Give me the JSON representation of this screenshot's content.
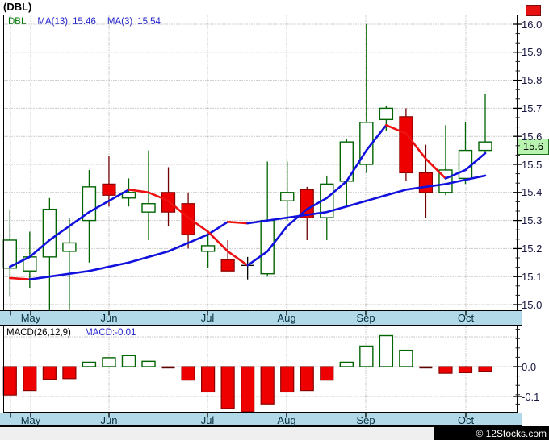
{
  "window": {
    "title": "(DBL)"
  },
  "price_panel": {
    "legend": {
      "symbol": "DBL",
      "ma13_label": "MA(13)",
      "ma13_value": "15.46",
      "ma3_label": "MA(3)",
      "ma3_value": "15.54"
    },
    "current_price": "15.6",
    "ytick_labels": [
      "16.0",
      "15.9",
      "15.8",
      "15.7",
      "15.6",
      "15.5",
      "15.4",
      "15.3",
      "15.2",
      "15.1",
      "15.0"
    ]
  },
  "macd_panel": {
    "legend_label": "MACD(26,12,9)",
    "legend_value": "MACD:-0.01",
    "ytick_labels": [
      "0.0",
      "-0.1"
    ]
  },
  "footer": {
    "copyright": "© 12Stocks.com"
  },
  "colors": {
    "band_blue": "#b2d9e8",
    "candle_up_stroke": "#006400",
    "candle_down_fill": "#ee0000",
    "candle_down_stroke": "#8b0000",
    "down_wick": "#700000",
    "doji": "#000000",
    "ma_rising_blue": "#1111dd",
    "ma_falling_red": "#ee1111",
    "grid": "#9a9a9a",
    "price_badge_bg": "#b9f3b0",
    "macd_flat_bar": "#5c0000",
    "legend_blue": "#2222cc",
    "symbol_green": "#007700",
    "red_button": "#e81111"
  },
  "chart_data": [
    {
      "type": "candlestick",
      "title": "(DBL)",
      "ylabel": "price",
      "ylim": [
        14.97,
        16.03
      ],
      "yticks": [
        16.0,
        15.9,
        15.8,
        15.7,
        15.6,
        15.5,
        15.4,
        15.3,
        15.2,
        15.1,
        15.0
      ],
      "grid": true,
      "month_ticks": [
        {
          "label": "May",
          "x": 38
        },
        {
          "label": "Jun",
          "x": 135
        },
        {
          "label": "Jul",
          "x": 257
        },
        {
          "label": "Aug",
          "x": 355
        },
        {
          "label": "Sep",
          "x": 453
        },
        {
          "label": "Oct",
          "x": 577
        }
      ],
      "lead_tick_x": 13,
      "candles": [
        {
          "o": 15.13,
          "h": 15.34,
          "l": 15.03,
          "c": 15.23
        },
        {
          "o": 15.12,
          "h": 15.26,
          "l": 15.06,
          "c": 15.17
        },
        {
          "o": 15.17,
          "h": 15.38,
          "l": 14.98,
          "c": 15.34
        },
        {
          "o": 15.19,
          "h": 15.31,
          "l": 14.98,
          "c": 15.22
        },
        {
          "o": 15.3,
          "h": 15.48,
          "l": 15.15,
          "c": 15.42
        },
        {
          "o": 15.43,
          "h": 15.53,
          "l": 15.35,
          "c": 15.39
        },
        {
          "o": 15.38,
          "h": 15.45,
          "l": 15.35,
          "c": 15.4
        },
        {
          "o": 15.33,
          "h": 15.55,
          "l": 15.23,
          "c": 15.36
        },
        {
          "o": 15.4,
          "h": 15.49,
          "l": 15.28,
          "c": 15.33
        },
        {
          "o": 15.36,
          "h": 15.4,
          "l": 15.2,
          "c": 15.25
        },
        {
          "o": 15.19,
          "h": 15.25,
          "l": 15.13,
          "c": 15.21
        },
        {
          "o": 15.16,
          "h": 15.23,
          "l": 15.12,
          "c": 15.12
        },
        {
          "o": 15.14,
          "h": 15.17,
          "l": 15.09,
          "c": 15.14
        },
        {
          "o": 15.11,
          "h": 15.51,
          "l": 15.1,
          "c": 15.3
        },
        {
          "o": 15.37,
          "h": 15.51,
          "l": 15.3,
          "c": 15.4
        },
        {
          "o": 15.41,
          "h": 15.42,
          "l": 15.23,
          "c": 15.31
        },
        {
          "o": 15.31,
          "h": 15.46,
          "l": 15.23,
          "c": 15.43
        },
        {
          "o": 15.44,
          "h": 15.59,
          "l": 15.35,
          "c": 15.58
        },
        {
          "o": 15.5,
          "h": 16.0,
          "l": 15.47,
          "c": 15.65
        },
        {
          "o": 15.66,
          "h": 15.71,
          "l": 15.62,
          "c": 15.7
        },
        {
          "o": 15.67,
          "h": 15.7,
          "l": 15.44,
          "c": 15.47
        },
        {
          "o": 15.47,
          "h": 15.57,
          "l": 15.31,
          "c": 15.4
        },
        {
          "o": 15.4,
          "h": 15.64,
          "l": 15.39,
          "c": 15.48
        },
        {
          "o": 15.45,
          "h": 15.65,
          "l": 15.43,
          "c": 15.55
        },
        {
          "o": 15.55,
          "h": 15.75,
          "l": 15.54,
          "c": 15.58
        }
      ],
      "ma3": {
        "name": "MA(3)",
        "last": 15.54,
        "values": [
          15.135,
          15.17,
          15.23,
          15.28,
          15.33,
          15.37,
          15.41,
          15.4,
          15.37,
          15.31,
          15.26,
          15.19,
          15.14,
          15.19,
          15.28,
          15.34,
          15.38,
          15.44,
          15.55,
          15.64,
          15.61,
          15.52,
          15.45,
          15.48,
          15.54
        ]
      },
      "ma13": {
        "name": "MA(13)",
        "last": 15.46,
        "values": [
          15.095,
          15.09,
          15.1,
          15.11,
          15.12,
          15.135,
          15.15,
          15.17,
          15.19,
          15.22,
          15.25,
          15.295,
          15.29,
          15.3,
          15.31,
          15.32,
          15.33,
          15.35,
          15.37,
          15.39,
          15.41,
          15.42,
          15.43,
          15.445,
          15.46
        ]
      }
    },
    {
      "type": "bar",
      "title": "MACD(26,12,9)",
      "last_value_label": "MACD:-0.01",
      "yticks": [
        0.0,
        -0.1
      ],
      "ylim": [
        -0.155,
        0.138
      ],
      "grid": true,
      "values": [
        -0.095,
        -0.08,
        -0.042,
        -0.04,
        0.015,
        0.03,
        0.037,
        0.018,
        -0.003,
        -0.045,
        -0.085,
        -0.14,
        -0.155,
        -0.125,
        -0.085,
        -0.08,
        -0.045,
        0.015,
        0.069,
        0.104,
        0.055,
        -0.003,
        -0.022,
        -0.02,
        -0.015
      ]
    }
  ]
}
